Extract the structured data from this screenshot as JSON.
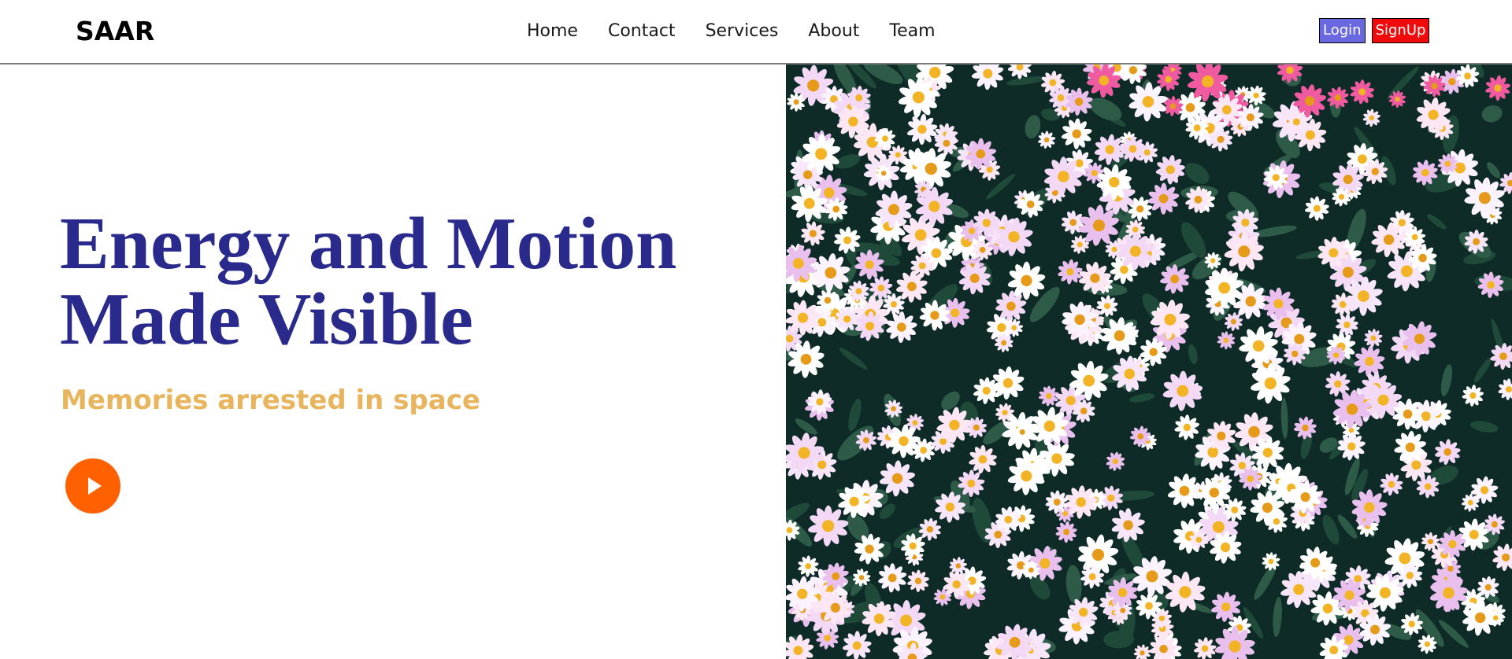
{
  "brand": {
    "name": "SAAR"
  },
  "nav": {
    "items": [
      {
        "label": "Home"
      },
      {
        "label": "Contact"
      },
      {
        "label": "Services"
      },
      {
        "label": "About"
      },
      {
        "label": "Team"
      }
    ]
  },
  "auth": {
    "login_label": "Login",
    "signup_label": "SignUp"
  },
  "hero": {
    "title_line1": "Energy and Motion",
    "title_line2": "Made Visible",
    "subtitle": "Memories arrested in space",
    "play_icon": "play-icon",
    "image_icon": "daisy-flowers-photo"
  },
  "colors": {
    "title": "#2a2a8c",
    "subtitle": "#e8b55e",
    "play": "#ff6100",
    "login": "#6a68e0",
    "signup": "#ef0b0b"
  }
}
